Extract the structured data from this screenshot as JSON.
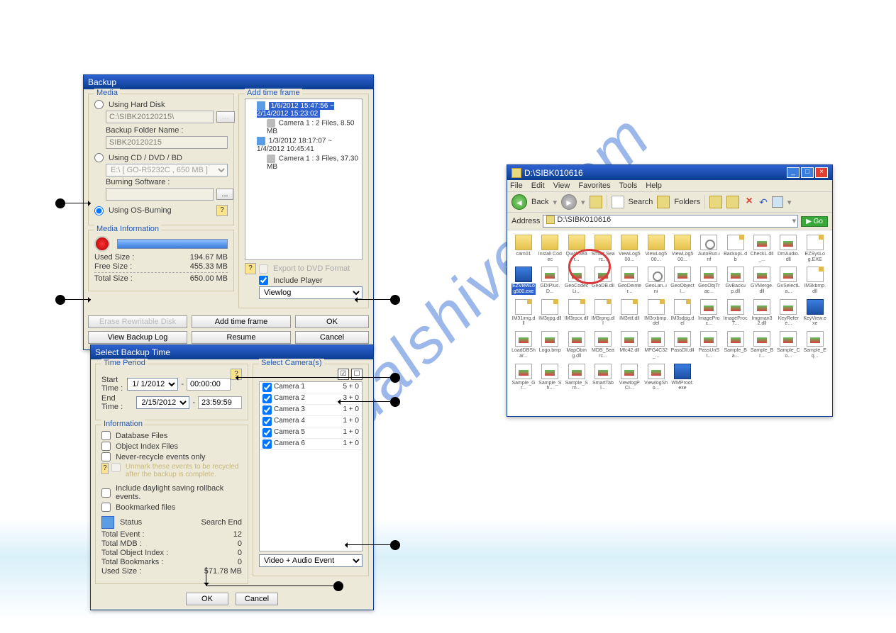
{
  "watermark": "manualshiver.com",
  "backup": {
    "title": "Backup",
    "media_group": "Media",
    "opt_harddisk": "Using Hard Disk",
    "harddisk_path": "C:\\SIBK20120215\\",
    "browse": "...",
    "folder_label": "Backup Folder Name :",
    "folder_value": "SIBK20120215",
    "opt_cd": "Using CD / DVD / BD",
    "cd_path": "E:\\ [ GO-R5232C , 650 MB ]",
    "burn_label": "Burning Software :",
    "opt_osburn": "Using OS-Burning",
    "media_info_group": "Media Information",
    "used_lbl": "Used Size :",
    "used_val": "194.67 MB",
    "free_lbl": "Free Size :",
    "free_val": "455.33 MB",
    "total_lbl": "Total Size :",
    "total_val": "650.00 MB",
    "addframe_group": "Add time frame",
    "tree_item1": "1/6/2012 15:47:56 ~ 2/14/2012 15:23:02",
    "tree_item1_child": "Camera 1 : 2 Files, 8.50 MB",
    "tree_item2": "1/3/2012 18:17:07 ~ 1/4/2012 10:45:41",
    "tree_item2_child": "Camera 1 : 3 Files, 37.30 MB",
    "export_dvd": "Export to DVD Format",
    "include_player": "Include Player",
    "player_combo": "Viewlog",
    "btn_erase": "Erase Rewritable Disk",
    "btn_addframe": "Add time frame",
    "btn_ok": "OK",
    "btn_viewlog": "View Backup Log",
    "btn_resume": "Resume",
    "btn_cancel": "Cancel"
  },
  "select": {
    "title": "Select Backup Time",
    "period_group": "Time Period",
    "start_lbl": "Start Time :",
    "start_date": "1/ 1/2012",
    "start_time": "00:00:00",
    "end_lbl": "End Time :",
    "end_date": "2/15/2012",
    "end_time": "23:59:59",
    "info_group": "Information",
    "cb_db": "Database Files",
    "cb_obj": "Object Index Files",
    "cb_never": "Never-recycle events only",
    "cb_unmark": "Unmark these events to be recycled after the backup is complete.",
    "cb_dst": "Include daylight saving rollback events.",
    "cb_bookmark": "Bookmarked files",
    "status_lbl": "Status",
    "status_val": "Search End",
    "r_event_k": "Total Event :",
    "r_event_v": "12",
    "r_mdb_k": "Total MDB :",
    "r_mdb_v": "0",
    "r_obj_k": "Total Object Index :",
    "r_obj_v": "0",
    "r_bk_k": "Total Bookmarks :",
    "r_bk_v": "0",
    "r_used_k": "Used Size :",
    "r_used_v": "571.78 MB",
    "cam_group": "Select Camera(s)",
    "cameras": [
      {
        "name": "Camera 1",
        "v": "5 + 0"
      },
      {
        "name": "Camera 2",
        "v": "3 + 0"
      },
      {
        "name": "Camera 3",
        "v": "1 + 0"
      },
      {
        "name": "Camera 4",
        "v": "1 + 0"
      },
      {
        "name": "Camera 5",
        "v": "1 + 0"
      },
      {
        "name": "Camera 6",
        "v": "1 + 0"
      }
    ],
    "event_combo": "Video + Audio Event",
    "btn_ok": "OK",
    "btn_cancel": "Cancel"
  },
  "explorer": {
    "title": "D:\\SIBK010616",
    "menu": [
      "File",
      "Edit",
      "View",
      "Favorites",
      "Tools",
      "Help"
    ],
    "back": "Back",
    "search": "Search",
    "folders": "Folders",
    "address_lbl": "Address",
    "address": "D:\\SIBK010616",
    "go": "Go",
    "items": [
      {
        "t": "folder",
        "n": "cam01"
      },
      {
        "t": "folder",
        "n": "Install Codec"
      },
      {
        "t": "folder",
        "n": "QuickSear..."
      },
      {
        "t": "folder",
        "n": "Smart Searc..."
      },
      {
        "t": "folder",
        "n": "ViewLog500..."
      },
      {
        "t": "folder",
        "n": "ViewLog500..."
      },
      {
        "t": "folder",
        "n": "ViewLog500..."
      },
      {
        "t": "ini",
        "n": "AutoRun.inf"
      },
      {
        "t": "file",
        "n": "BackupL.db"
      },
      {
        "t": "img",
        "n": "CheckL.dll_..."
      },
      {
        "t": "img",
        "n": "DmAudio.dll"
      },
      {
        "t": "file",
        "n": "EZSysLog.EXE"
      },
      {
        "t": "exe",
        "n": "EZViewLog500.exe",
        "sel": true
      },
      {
        "t": "img",
        "n": "GDIPlus.D..."
      },
      {
        "t": "img",
        "n": "GeoCodecLi..."
      },
      {
        "t": "img",
        "n": "GeoDB.dll"
      },
      {
        "t": "img",
        "n": "GeoDeinter..."
      },
      {
        "t": "ini",
        "n": "GeoLan..ini"
      },
      {
        "t": "img",
        "n": "GeoObjectI..."
      },
      {
        "t": "img",
        "n": "GeoObjTrac..."
      },
      {
        "t": "img",
        "n": "GvBackup.dll"
      },
      {
        "t": "img",
        "n": "GVMerge.dll"
      },
      {
        "t": "img",
        "n": "GvSelectLa..."
      },
      {
        "t": "file",
        "n": "IM3kbmp.dll"
      },
      {
        "t": "file",
        "n": "IM31img.dll"
      },
      {
        "t": "file",
        "n": "IM3rjpg.dll"
      },
      {
        "t": "file",
        "n": "IM3rpcx.dll"
      },
      {
        "t": "file",
        "n": "IM3rpng.dll"
      },
      {
        "t": "file",
        "n": "IM3rtif.dll"
      },
      {
        "t": "file",
        "n": "IM3rxbmp.del"
      },
      {
        "t": "file",
        "n": "IM3sdpg.del"
      },
      {
        "t": "img",
        "n": "ImageProc..."
      },
      {
        "t": "img",
        "n": "ImageProcT..."
      },
      {
        "t": "img",
        "n": "Imgman32.dll"
      },
      {
        "t": "img",
        "n": "KeyRefere..."
      },
      {
        "t": "exe",
        "n": "KeyView.exe"
      },
      {
        "t": "img",
        "n": "LoadDBShar..."
      },
      {
        "t": "img",
        "n": "Logo.bmp"
      },
      {
        "t": "img",
        "n": "MapObing.dll"
      },
      {
        "t": "img",
        "n": "MDB_Searc..."
      },
      {
        "t": "img",
        "n": "Mfc42.dll"
      },
      {
        "t": "img",
        "n": "MPG4C32_..."
      },
      {
        "t": "img",
        "n": "PassDll.dll"
      },
      {
        "t": "img",
        "n": "PassUnSt..."
      },
      {
        "t": "img",
        "n": "Sample_Ba..."
      },
      {
        "t": "img",
        "n": "Sample_Br..."
      },
      {
        "t": "img",
        "n": "Sample_Co..."
      },
      {
        "t": "img",
        "n": "Sample_Eq..."
      },
      {
        "t": "img",
        "n": "Sample_Gr..."
      },
      {
        "t": "img",
        "n": "Sample_Sh..."
      },
      {
        "t": "img",
        "n": "Sample_Sm..."
      },
      {
        "t": "img",
        "n": "SmartTabl..."
      },
      {
        "t": "img",
        "n": "ViewlogPCI..."
      },
      {
        "t": "img",
        "n": "ViewlogSho..."
      },
      {
        "t": "exe",
        "n": "WMProof.exe"
      }
    ]
  }
}
